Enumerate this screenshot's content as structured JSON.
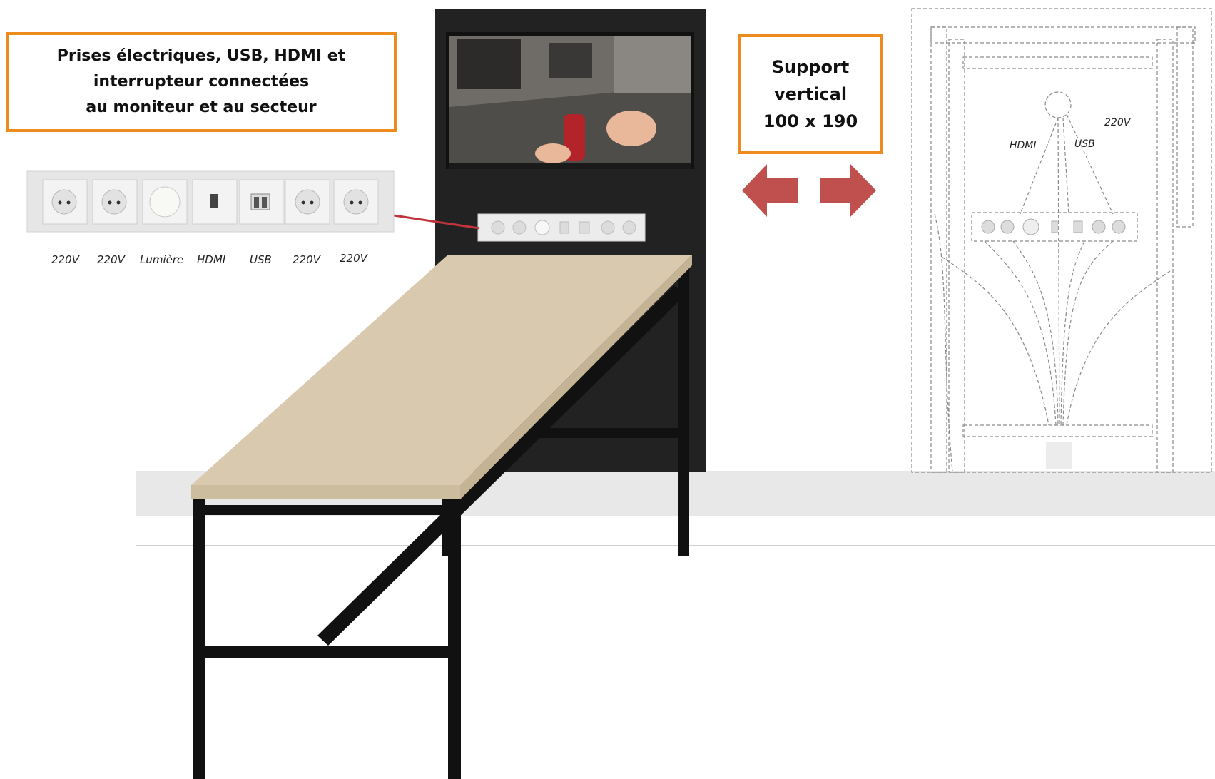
{
  "callouts": {
    "left": [
      "Prises électriques, USB, HDMI et",
      "interrupteur connectées",
      "au moniteur et au secteur"
    ],
    "right": [
      "Support",
      "vertical",
      "100 x 190"
    ]
  },
  "panel_labels": [
    "220V",
    "220V",
    "Lumière",
    "HDMI",
    "USB",
    "220V",
    "220V"
  ],
  "schematic_labels": {
    "hdmi": "HDMI",
    "usb": "USB",
    "v220": "220V"
  },
  "colors": {
    "callout_border": "#ED8B1F",
    "arrow": "#C0504D",
    "tabletop": "#D9C9AE",
    "totem": "#222222",
    "connector_line": "#C0343C"
  }
}
